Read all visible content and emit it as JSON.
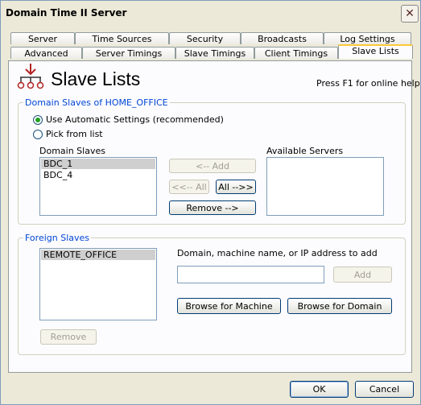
{
  "window": {
    "title": "Domain Time II Server",
    "close_symbol": "✕"
  },
  "tabs_row1": [
    {
      "label": "Server"
    },
    {
      "label": "Time Sources"
    },
    {
      "label": "Security"
    },
    {
      "label": "Broadcasts"
    },
    {
      "label": "Log Settings"
    }
  ],
  "tabs_row2": [
    {
      "label": "Advanced"
    },
    {
      "label": "Server Timings"
    },
    {
      "label": "Slave Timings"
    },
    {
      "label": "Client Timings"
    },
    {
      "label": "Slave Lists",
      "active": true
    }
  ],
  "page": {
    "heading": "Slave Lists",
    "help": "Press F1 for online help",
    "icon": "network-slaves-icon"
  },
  "domain_group": {
    "title": "Domain Slaves of HOME_OFFICE",
    "radio_auto": "Use Automatic Settings (recommended)",
    "radio_pick": "Pick from list",
    "domain_slaves_label": "Domain Slaves",
    "domain_slaves": [
      "BDC_1",
      "BDC_4"
    ],
    "available_label": "Available Servers",
    "btn_add": "<-- Add",
    "btn_add_all": "<<-- All",
    "btn_all": "All -->>",
    "btn_remove": "Remove -->"
  },
  "foreign_group": {
    "title": "Foreign Slaves",
    "slaves": [
      "REMOTE_OFFICE"
    ],
    "input_label": "Domain, machine name, or IP address to add",
    "input_value": "",
    "btn_add": "Add",
    "btn_browse_machine": "Browse for Machine",
    "btn_browse_domain": "Browse for Domain",
    "btn_remove": "Remove"
  },
  "footer": {
    "ok": "OK",
    "cancel": "Cancel"
  },
  "colors": {
    "accent_tab": "#FFC83C",
    "group_label": "#0046D5",
    "radio_dot": "#21A121"
  }
}
